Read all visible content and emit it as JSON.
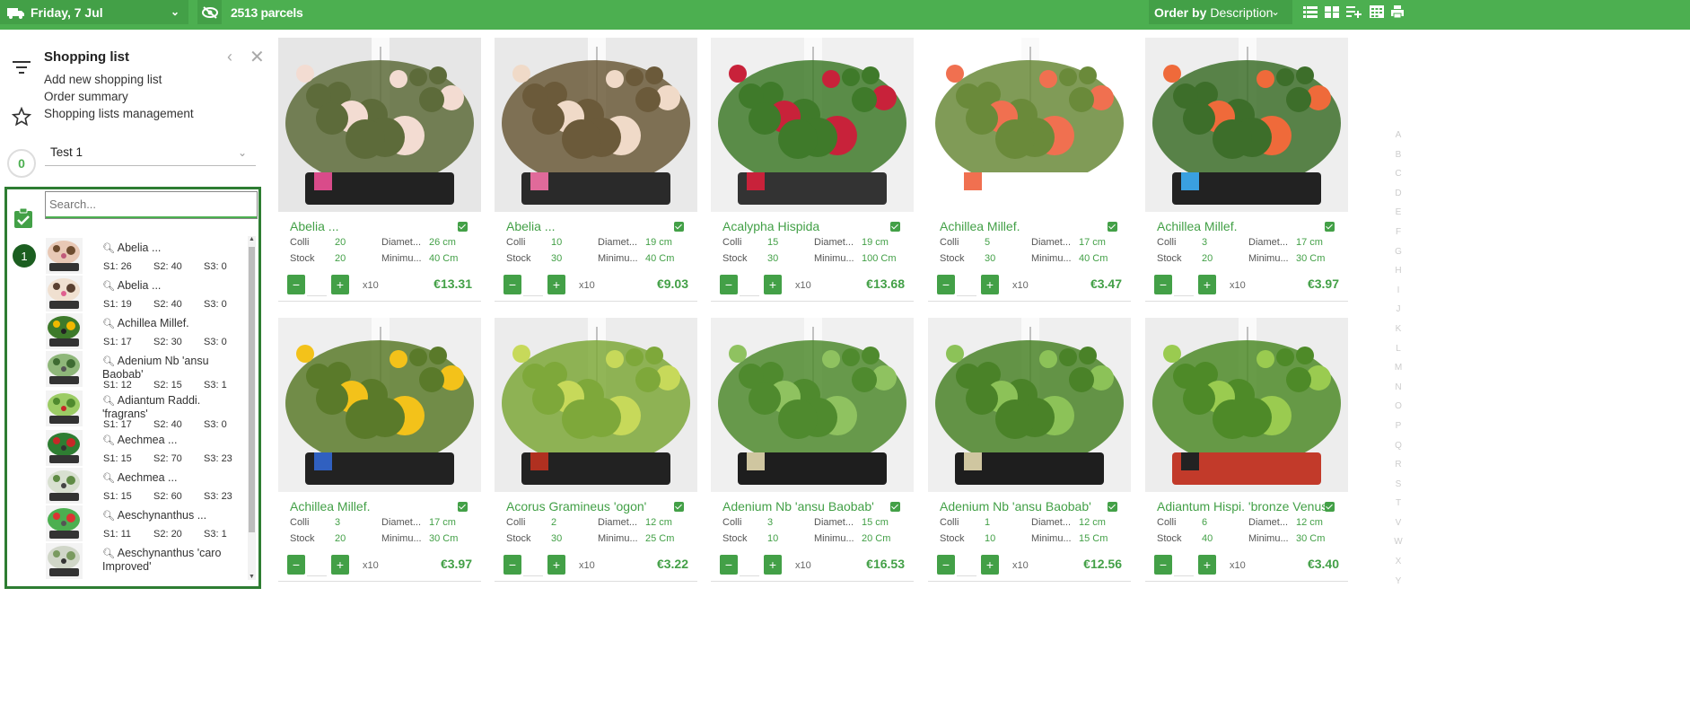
{
  "topbar": {
    "date": "Friday, 7 Jul",
    "parcels": "2513 parcels",
    "order_by_label": "Order by",
    "order_by_value": "Description",
    "icons": [
      "list-view-icon",
      "grid-view-icon",
      "playlist-add-icon",
      "calendar-view-icon",
      "print-icon"
    ],
    "colors": {
      "bar": "#4caf50",
      "box": "#43a047"
    }
  },
  "sidebar": {
    "title": "Shopping list",
    "links": [
      "Add new shopping list",
      "Order summary",
      "Shopping lists management"
    ],
    "count": "0",
    "selected_list": "Test 1",
    "search_placeholder": "Search...",
    "badge": "1",
    "items": [
      {
        "name": "Abelia ...",
        "s1": "S1: 26",
        "s2": "S2: 40",
        "s3": "S3: 0"
      },
      {
        "name": "Abelia ...",
        "s1": "S1: 19",
        "s2": "S2: 40",
        "s3": "S3: 0"
      },
      {
        "name": "Achillea Millef.",
        "s1": "S1: 17",
        "s2": "S2: 30",
        "s3": "S3: 0"
      },
      {
        "name": "Adenium Nb 'ansu Baobab'",
        "s1": "S1: 12",
        "s2": "S2: 15",
        "s3": "S3: 1"
      },
      {
        "name": "Adiantum Raddi. 'fragrans'",
        "s1": "S1: 17",
        "s2": "S2: 40",
        "s3": "S3: 0"
      },
      {
        "name": "Aechmea ...",
        "s1": "S1: 15",
        "s2": "S2: 70",
        "s3": "S3: 23"
      },
      {
        "name": "Aechmea ...",
        "s1": "S1: 15",
        "s2": "S2: 60",
        "s3": "S3: 23"
      },
      {
        "name": "Aeschynanthus ...",
        "s1": "S1: 11",
        "s2": "S2: 20",
        "s3": "S3: 1"
      },
      {
        "name": "Aeschynanthus 'caro Improved'",
        "s1": "",
        "s2": "",
        "s3": ""
      }
    ]
  },
  "labels": {
    "colli": "Colli",
    "stock": "Stock",
    "diameter": "Diamet...",
    "minimum": "Minimu...",
    "mult": "x10",
    "minus": "−",
    "plus": "+"
  },
  "products": [
    {
      "name": "Abelia ...",
      "colli": "20",
      "stock": "20",
      "diameter": "26 cm",
      "minimum": "40 Cm",
      "price": "€13.31"
    },
    {
      "name": "Abelia ...",
      "colli": "10",
      "stock": "30",
      "diameter": "19 cm",
      "minimum": "40 Cm",
      "price": "€9.03"
    },
    {
      "name": "Acalypha Hispida",
      "colli": "15",
      "stock": "30",
      "diameter": "19 cm",
      "minimum": "100 Cm",
      "price": "€13.68"
    },
    {
      "name": "Achillea Millef.",
      "colli": "5",
      "stock": "30",
      "diameter": "17 cm",
      "minimum": "40 Cm",
      "price": "€3.47"
    },
    {
      "name": "Achillea Millef.",
      "colli": "3",
      "stock": "20",
      "diameter": "17 cm",
      "minimum": "30 Cm",
      "price": "€3.97"
    },
    {
      "name": "Achillea Millef.",
      "colli": "3",
      "stock": "20",
      "diameter": "17 cm",
      "minimum": "30 Cm",
      "price": "€3.97"
    },
    {
      "name": "Acorus Gramineus 'ogon'",
      "colli": "2",
      "stock": "30",
      "diameter": "12 cm",
      "minimum": "25 Cm",
      "price": "€3.22"
    },
    {
      "name": "Adenium Nb 'ansu Baobab'",
      "colli": "3",
      "stock": "10",
      "diameter": "15 cm",
      "minimum": "20 Cm",
      "price": "€16.53"
    },
    {
      "name": "Adenium Nb 'ansu Baobab'",
      "colli": "1",
      "stock": "10",
      "diameter": "12 cm",
      "minimum": "15 Cm",
      "price": "€12.56"
    },
    {
      "name": "Adiantum Hispi. 'bronze Venus",
      "colli": "6",
      "stock": "40",
      "diameter": "12 cm",
      "minimum": "30 Cm",
      "price": "€3.40"
    }
  ],
  "alphabet": [
    "A",
    "B",
    "C",
    "D",
    "E",
    "F",
    "G",
    "H",
    "I",
    "J",
    "K",
    "L",
    "M",
    "N",
    "O",
    "P",
    "Q",
    "R",
    "S",
    "T",
    "V",
    "W",
    "X",
    "Y"
  ]
}
